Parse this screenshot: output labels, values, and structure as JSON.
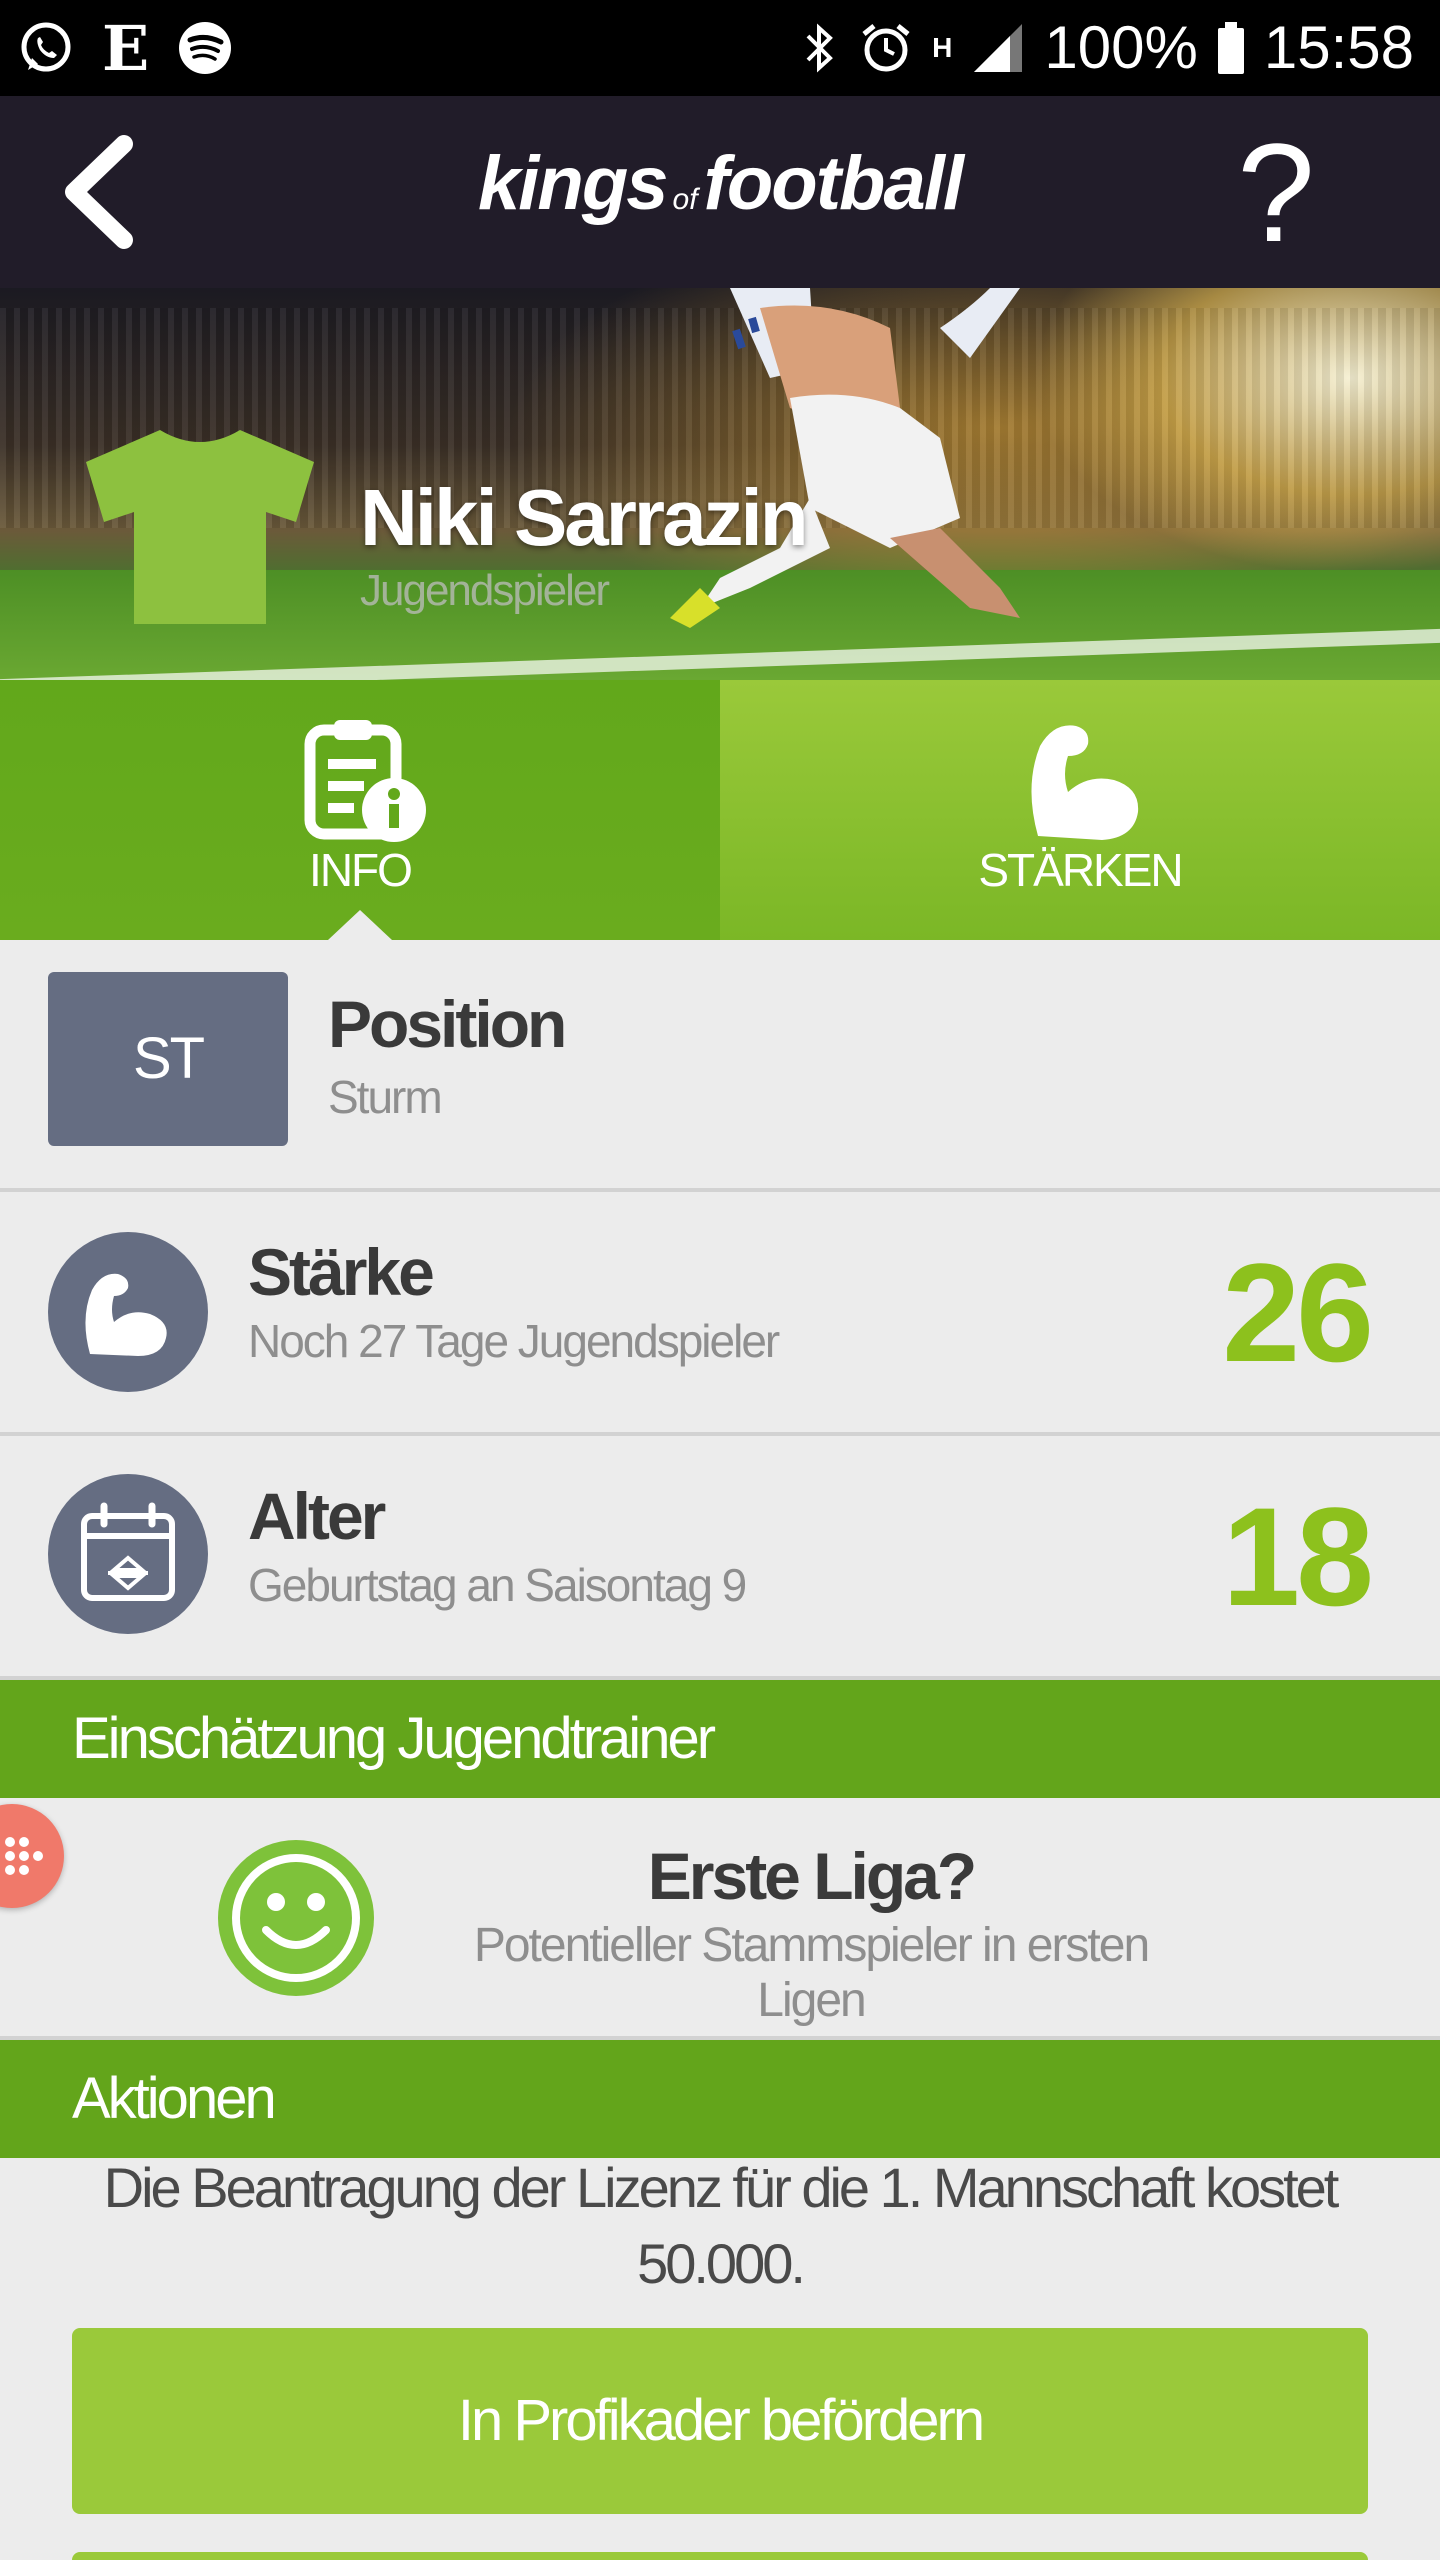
{
  "status_bar": {
    "left_icons": [
      "whatsapp-icon",
      "e-app-icon",
      "spotify-icon"
    ],
    "e_label": "E",
    "battery": "100%",
    "time": "15:58",
    "network": "H"
  },
  "app_bar": {
    "logo_left": "kings",
    "logo_of": "of",
    "logo_right": "football",
    "help_label": "?"
  },
  "player": {
    "name": "Niki Sarrazin",
    "role": "Jugendspieler",
    "shirt_color": "#8dc13f"
  },
  "tabs": [
    {
      "label": "INFO",
      "icon": "clipboard-info-icon",
      "active": true
    },
    {
      "label": "STÄRKEN",
      "icon": "muscle-arm-icon",
      "active": false
    }
  ],
  "position": {
    "badge": "ST",
    "title": "Position",
    "value": "Sturm"
  },
  "strength": {
    "title": "Stärke",
    "subtitle": "Noch 27 Tage Jugendspieler",
    "value": "26"
  },
  "age": {
    "title": "Alter",
    "subtitle": "Geburtstag an Saisontag 9",
    "value": "18"
  },
  "assessment": {
    "header": "Einschätzung Jugendtrainer",
    "title": "Erste Liga?",
    "subtitle": "Potentieller Stammspieler in ersten Ligen",
    "icon": "smiley-icon"
  },
  "actions": {
    "header": "Aktionen",
    "text": "Die Beantragung der Lizenz für die 1. Mannschaft kostet 50.000.",
    "promote_label": "In Profikader befördern"
  },
  "colors": {
    "app_bar": "#211c29",
    "accent_green": "#8dc11d",
    "section_green": "#63a51b",
    "button_green": "#9ac93a",
    "badge_gray": "#656d82"
  }
}
